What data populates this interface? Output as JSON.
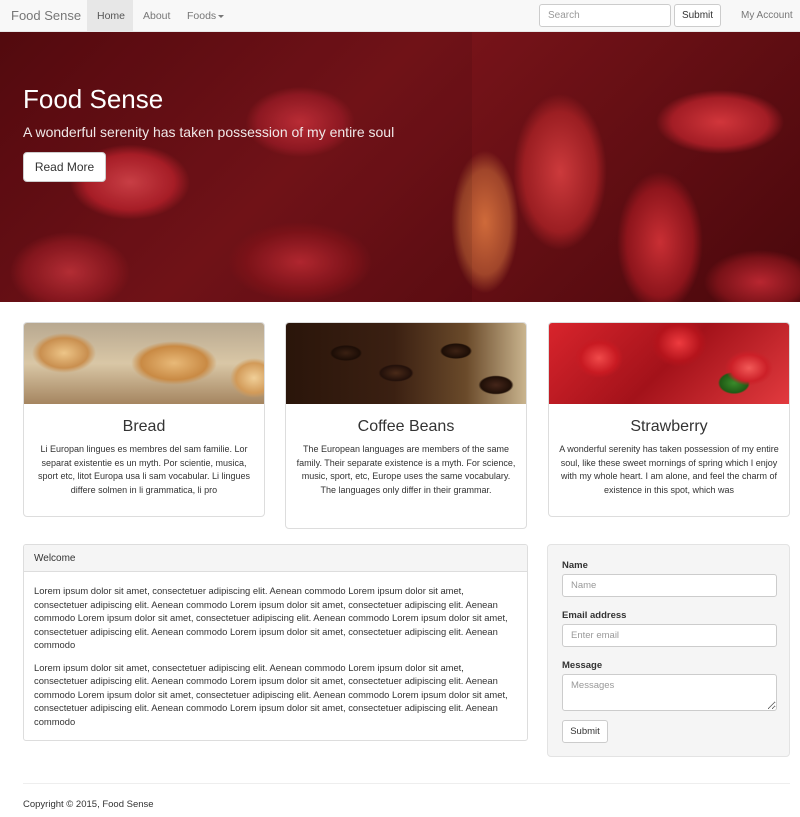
{
  "navbar": {
    "brand": "Food Sense",
    "items": [
      {
        "label": "Home",
        "active": true
      },
      {
        "label": "About",
        "active": false
      },
      {
        "label": "Foods",
        "active": false,
        "dropdown": true
      }
    ],
    "search": {
      "placeholder": "Search",
      "value": "",
      "button_label": "Submit"
    },
    "account_label": "My Account"
  },
  "hero": {
    "title": "Food Sense",
    "subtitle": "A wonderful serenity has taken possession of my entire soul",
    "button_label": "Read More"
  },
  "cards": [
    {
      "title": "Bread",
      "text": "Li Europan lingues es membres del sam familie. Lor separat existentie es un myth. Por scientie, musica, sport etc, litot Europa usa li sam vocabular. Li lingues differe solmen in li grammatica, li pro"
    },
    {
      "title": "Coffee Beans",
      "text": "The European languages are members of the same family. Their separate existence is a myth. For science, music, sport, etc, Europe uses the same vocabulary. The languages only differ in their grammar."
    },
    {
      "title": "Strawberry",
      "text": "A wonderful serenity has taken possession of my entire soul, like these sweet mornings of spring which I enjoy with my whole heart. I am alone, and feel the charm of existence in this spot, which was"
    }
  ],
  "welcome": {
    "heading": "Welcome",
    "paragraphs": [
      "Lorem ipsum dolor sit amet, consectetuer adipiscing elit. Aenean commodo Lorem ipsum dolor sit amet, consectetuer adipiscing elit. Aenean commodo Lorem ipsum dolor sit amet, consectetuer adipiscing elit. Aenean commodo Lorem ipsum dolor sit amet, consectetuer adipiscing elit. Aenean commodo Lorem ipsum dolor sit amet, consectetuer adipiscing elit. Aenean commodo Lorem ipsum dolor sit amet, consectetuer adipiscing elit. Aenean commodo",
      "Lorem ipsum dolor sit amet, consectetuer adipiscing elit. Aenean commodo Lorem ipsum dolor sit amet, consectetuer adipiscing elit. Aenean commodo Lorem ipsum dolor sit amet, consectetuer adipiscing elit. Aenean commodo Lorem ipsum dolor sit amet, consectetuer adipiscing elit. Aenean commodo Lorem ipsum dolor sit amet, consectetuer adipiscing elit. Aenean commodo Lorem ipsum dolor sit amet, consectetuer adipiscing elit. Aenean commodo"
    ]
  },
  "contact_form": {
    "name_label": "Name",
    "name_placeholder": "Name",
    "email_label": "Email address",
    "email_placeholder": "Enter email",
    "message_label": "Message",
    "message_placeholder": "Messages",
    "submit_label": "Submit"
  },
  "footer": {
    "copyright": "Copyright © 2015, Food Sense"
  }
}
